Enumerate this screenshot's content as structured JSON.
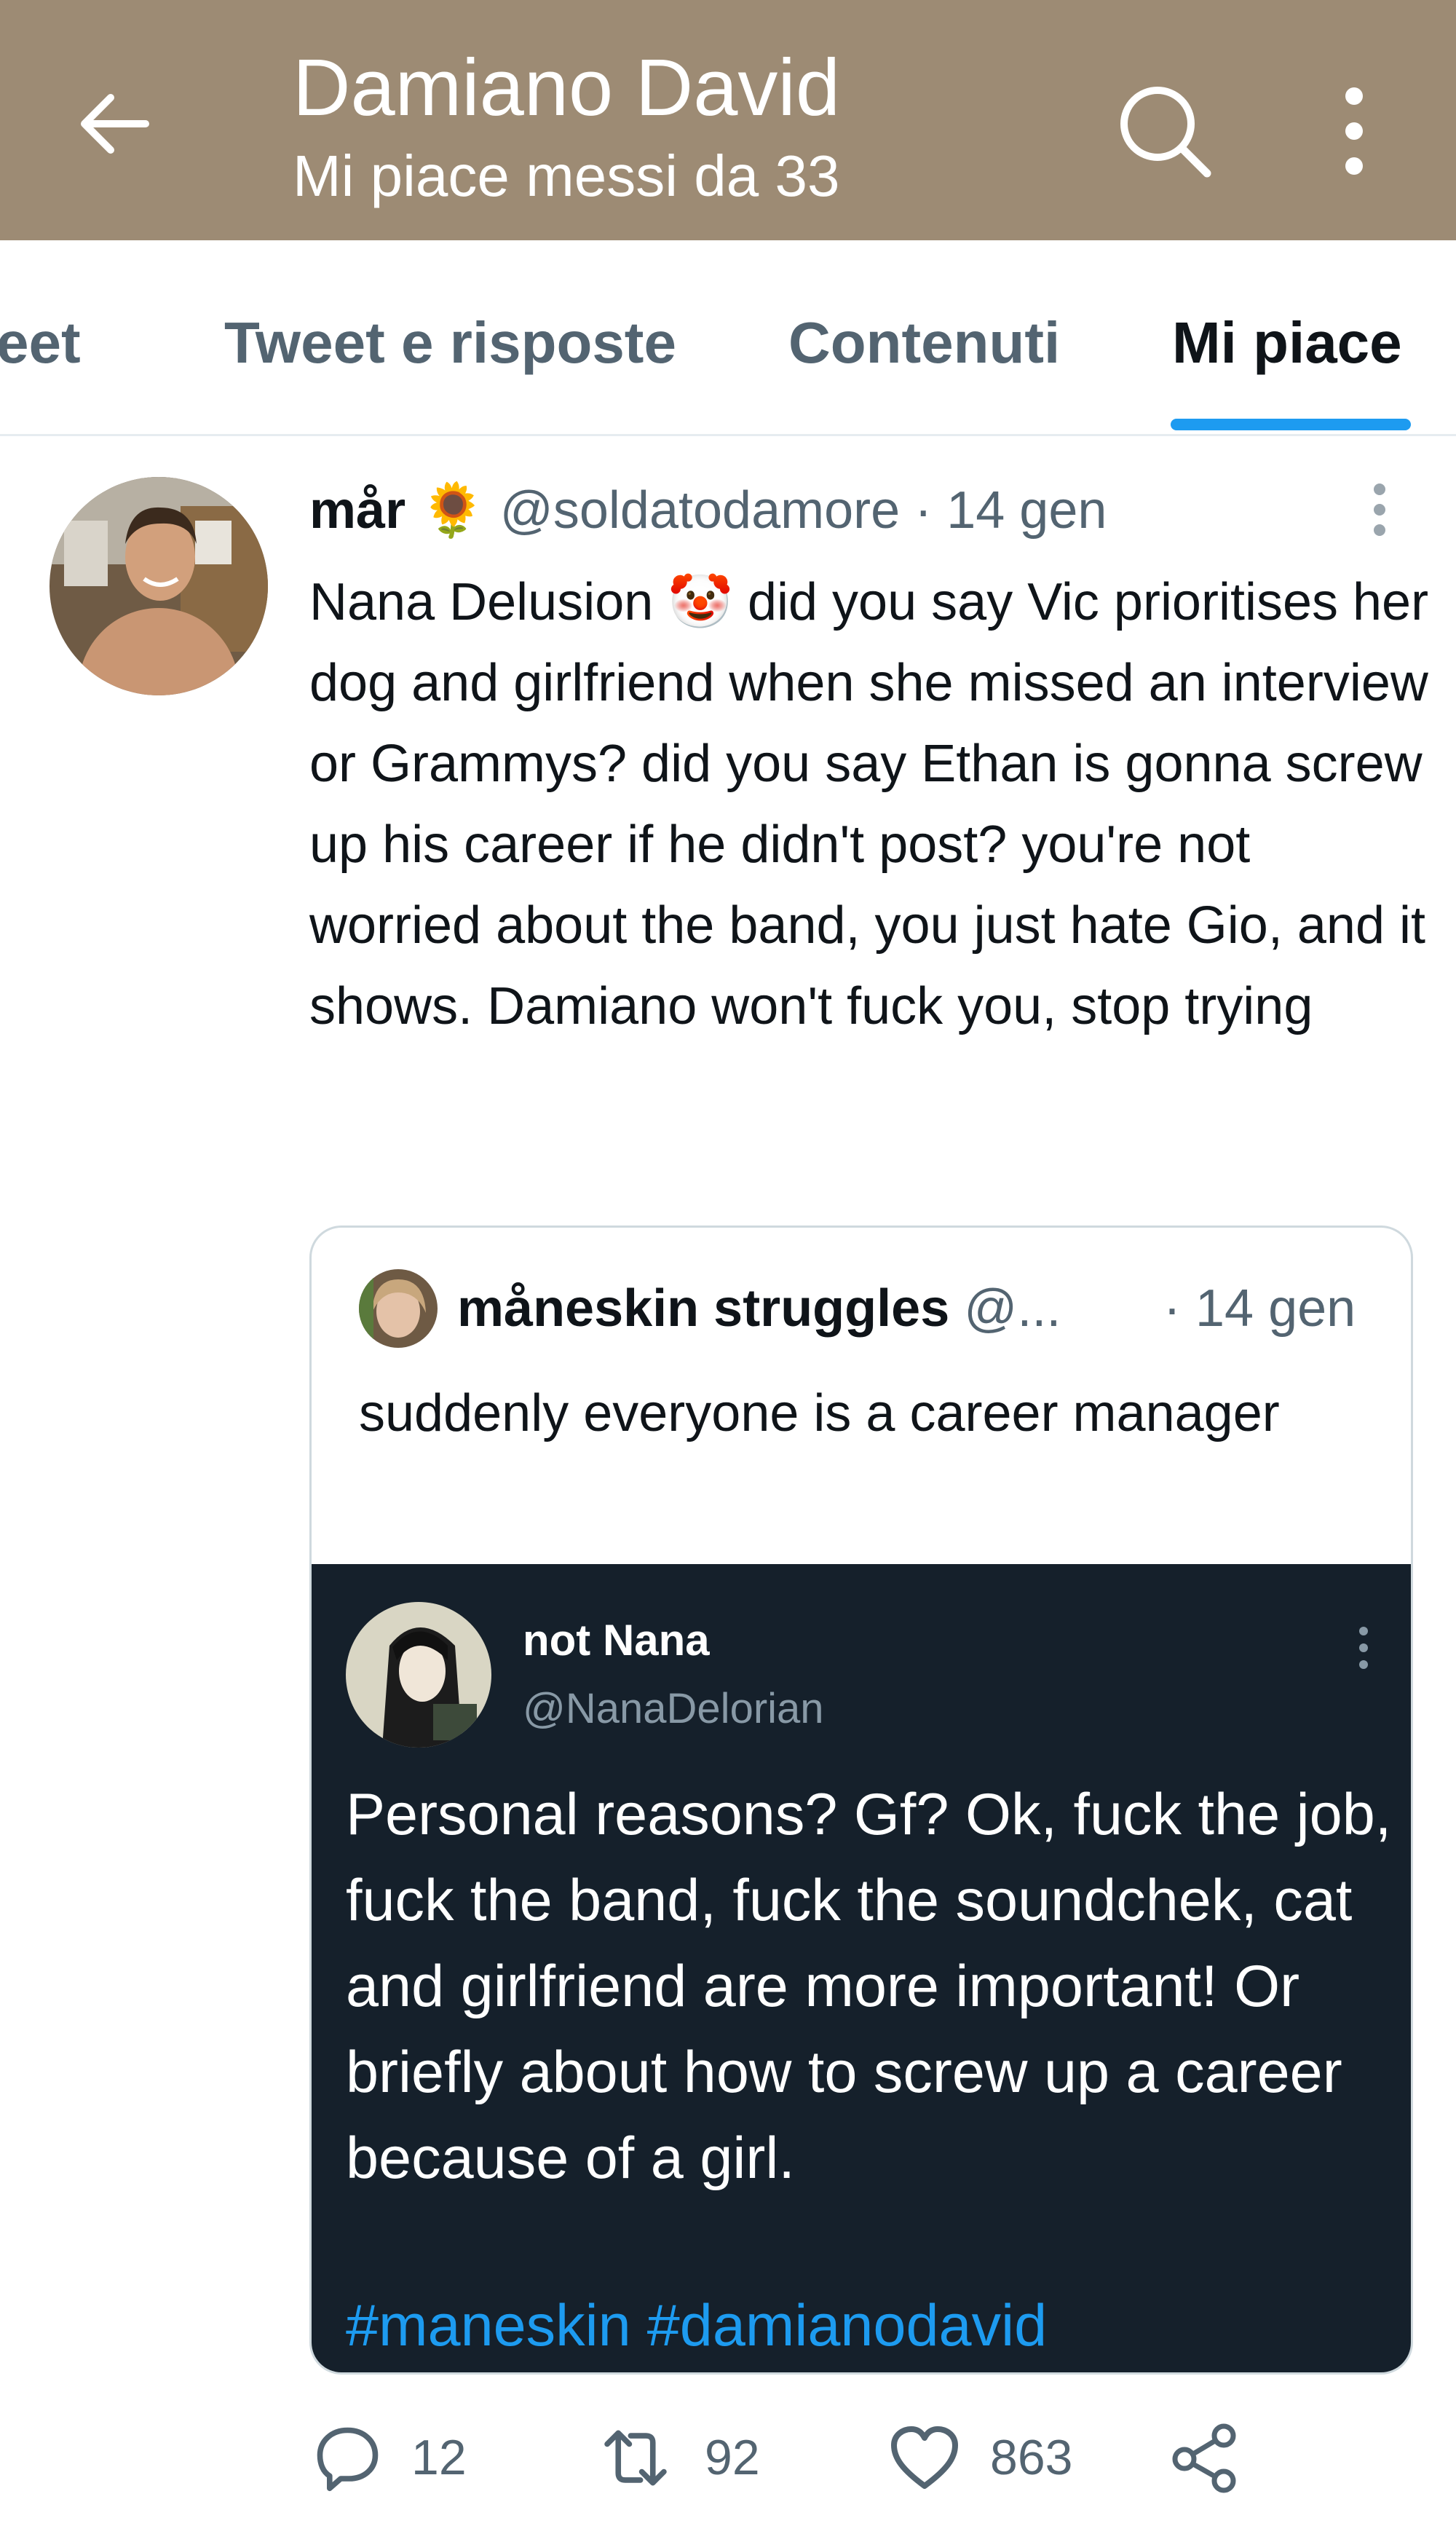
{
  "header": {
    "title": "Damiano David",
    "subtitle": "Mi piace messi da 33",
    "back_icon": "arrow-left-icon",
    "search_icon": "search-icon",
    "more_icon": "more-vertical-icon",
    "background": "#9d8b74"
  },
  "tabs": [
    {
      "label": "eet"
    },
    {
      "label": "Tweet e risposte"
    },
    {
      "label": "Contenuti"
    },
    {
      "label": "Mi piace",
      "active": true
    }
  ],
  "tweet": {
    "name": "mår",
    "name_emoji": "🌻",
    "handle": "@soldatodamore",
    "separator": "·",
    "date": "14 gen",
    "text_lead": "Nana Delusion",
    "text_emoji": "🤡",
    "text_rest": " did you say Vic prioritises her dog and girlfriend when she missed an interview or Grammys? did you say Ethan is gonna screw up his career if he didn't post? you're not worried about the band, you just hate Gio, and it shows. Damiano won't fuck you, stop trying",
    "quoted": {
      "name": "måneskin struggles",
      "handle": "@...",
      "date": "· 14 gen",
      "text": "suddenly everyone is a career manager",
      "embedded": {
        "name": "not Nana",
        "handle": "@NanaDelorian",
        "text": "Personal reasons? Gf? Ok, fuck the job, fuck the band, fuck the soundchek, cat and girlfriend are more important! Or briefly about how to screw up a career because of a girl.",
        "hashtags": [
          "#maneskin",
          "#damianodavid"
        ]
      }
    },
    "actions": {
      "replies": "12",
      "retweets": "92",
      "likes": "863",
      "reply_icon": "reply-icon",
      "retweet_icon": "retweet-icon",
      "like_icon": "heart-icon",
      "share_icon": "share-icon"
    }
  },
  "colors": {
    "accent": "#1d9bf0",
    "muted": "#536471",
    "dark_bg": "#15202b"
  }
}
